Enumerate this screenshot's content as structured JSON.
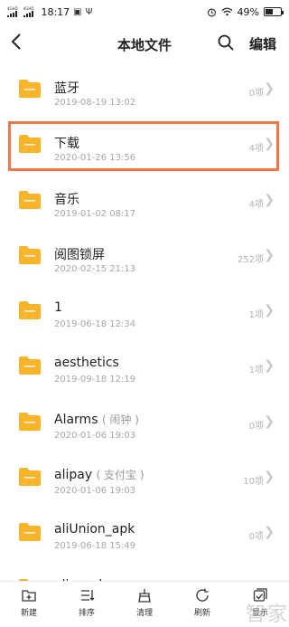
{
  "status_bar": {
    "network_tag_1": "4GHD",
    "network_tag_2": "4GHD",
    "time": "18:17",
    "battery_percent": "49%",
    "battery_level": 0.49
  },
  "header": {
    "title": "本地文件",
    "edit_label": "编辑"
  },
  "folders": [
    {
      "name": "蓝牙",
      "alias": "",
      "date": "2019-08-19 13:02",
      "count": "0项"
    },
    {
      "name": "下载",
      "alias": "",
      "date": "2020-01-26 13:56",
      "count": "4项"
    },
    {
      "name": "音乐",
      "alias": "",
      "date": "2019-01-02 08:17",
      "count": "4项"
    },
    {
      "name": "阅图锁屏",
      "alias": "",
      "date": "2020-02-15 21:13",
      "count": "252项"
    },
    {
      "name": "1",
      "alias": "",
      "date": "2019-06-18 12:34",
      "count": "1项"
    },
    {
      "name": "aesthetics",
      "alias": "",
      "date": "2019-09-18 12:19",
      "count": "1项"
    },
    {
      "name": "Alarms",
      "alias": "( 闹钟 )",
      "date": "2020-01-06 19:03",
      "count": "0项"
    },
    {
      "name": "alipay",
      "alias": "( 支付宝 )",
      "date": "2020-01-06 19:03",
      "count": "10项"
    },
    {
      "name": "aliUnion_apk",
      "alias": "",
      "date": "2019-06-18 15:49",
      "count": "0项"
    },
    {
      "name": "aliyun_log",
      "alias": "",
      "date": "",
      "count": ""
    }
  ],
  "toolbar": {
    "new_label": "新建",
    "sort_label": "排序",
    "clean_label": "清理",
    "refresh_label": "刷新",
    "display_label": "显示"
  },
  "watermark": "智家",
  "colors": {
    "folder": "#f8b42a",
    "highlight": "#f2784b"
  }
}
